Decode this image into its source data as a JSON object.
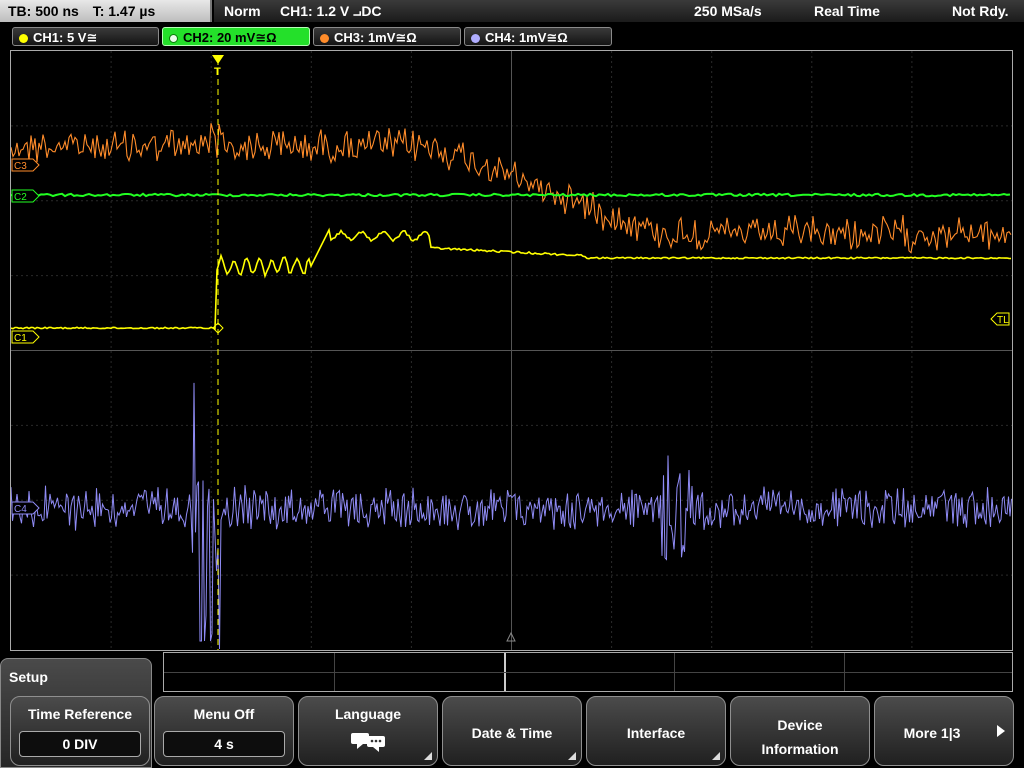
{
  "timebase": {
    "tb_label": "TB: 500 ns",
    "t_label": "T: 1.47 µs"
  },
  "status": {
    "mode": "Norm",
    "trigger": "CH1: 1.2 V ⨼DC",
    "sample_rate": "250 MSa/s",
    "acq_mode": "Real Time",
    "state": "Not Rdy."
  },
  "channels": [
    {
      "label": "CH1: 5 V≅",
      "color": "#ffff00",
      "active": false
    },
    {
      "label": "CH2: 20 mV≅Ω",
      "color": "#22ff22",
      "active": true
    },
    {
      "label": "CH3: 1mV≅Ω",
      "color": "#ff8c2a",
      "active": false
    },
    {
      "label": "CH4: 1mV≅Ω",
      "color": "#8f8bf5",
      "active": false
    }
  ],
  "markers": {
    "c3": "C3",
    "c2": "C2",
    "c1": "C1",
    "c4": "C4",
    "trigger_level": "TL",
    "trigger_pos": "T"
  },
  "menu": {
    "title": "Setup",
    "softkeys": [
      {
        "label": "Time Reference",
        "value": "0 DIV"
      },
      {
        "label": "Menu Off",
        "value": "4 s"
      },
      {
        "label": "Language",
        "icon": "speech-bubble-icon"
      },
      {
        "label": "Date & Time"
      },
      {
        "label": "Interface"
      },
      {
        "label": "Device Information"
      },
      {
        "label": "More 1|3"
      }
    ]
  }
}
